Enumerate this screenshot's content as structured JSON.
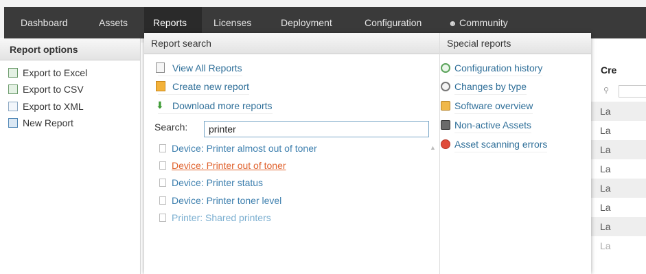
{
  "nav": {
    "items": [
      {
        "label": "Dashboard"
      },
      {
        "label": "Assets"
      },
      {
        "label": "Reports"
      },
      {
        "label": "Licenses"
      },
      {
        "label": "Deployment"
      },
      {
        "label": "Configuration"
      },
      {
        "label": "Community"
      }
    ],
    "active": "Reports",
    "community_icon": "people-icon"
  },
  "report_options": {
    "title": "Report options",
    "items": [
      {
        "label": "Export to Excel",
        "icon": "excel-icon"
      },
      {
        "label": "Export to CSV",
        "icon": "csv-icon"
      },
      {
        "label": "Export to XML",
        "icon": "xml-icon"
      },
      {
        "label": "New Report",
        "icon": "new-report-icon"
      }
    ]
  },
  "report_search": {
    "title": "Report search",
    "links": [
      {
        "label": "View All Reports",
        "icon": "list-icon"
      },
      {
        "label": "Create new report",
        "icon": "edit-icon"
      },
      {
        "label": "Download more reports",
        "icon": "download-icon"
      }
    ],
    "search_label": "Search:",
    "search_value": "printer",
    "results": [
      {
        "label": "Device: Printer almost out of toner"
      },
      {
        "label": "Device: Printer out of toner"
      },
      {
        "label": "Device: Printer status"
      },
      {
        "label": "Device: Printer toner level"
      },
      {
        "label": "Printer: Shared printers"
      }
    ]
  },
  "special_reports": {
    "title": "Special reports",
    "items": [
      {
        "label": "Configuration history",
        "icon": "history-icon"
      },
      {
        "label": "Changes by type",
        "icon": "clock-icon"
      },
      {
        "label": "Software overview",
        "icon": "software-icon"
      },
      {
        "label": "Non-active Assets",
        "icon": "inactive-asset-icon"
      },
      {
        "label": "Asset scanning errors",
        "icon": "error-icon"
      }
    ]
  },
  "table": {
    "header": "Cre",
    "cells": [
      "La",
      "La",
      "La",
      "La",
      "La",
      "La",
      "La",
      "La"
    ]
  },
  "colors": {
    "nav_bg": "#3a3a3a",
    "link": "#2f6f99",
    "hover_link": "#e0622d",
    "error": "#e04b3a"
  }
}
